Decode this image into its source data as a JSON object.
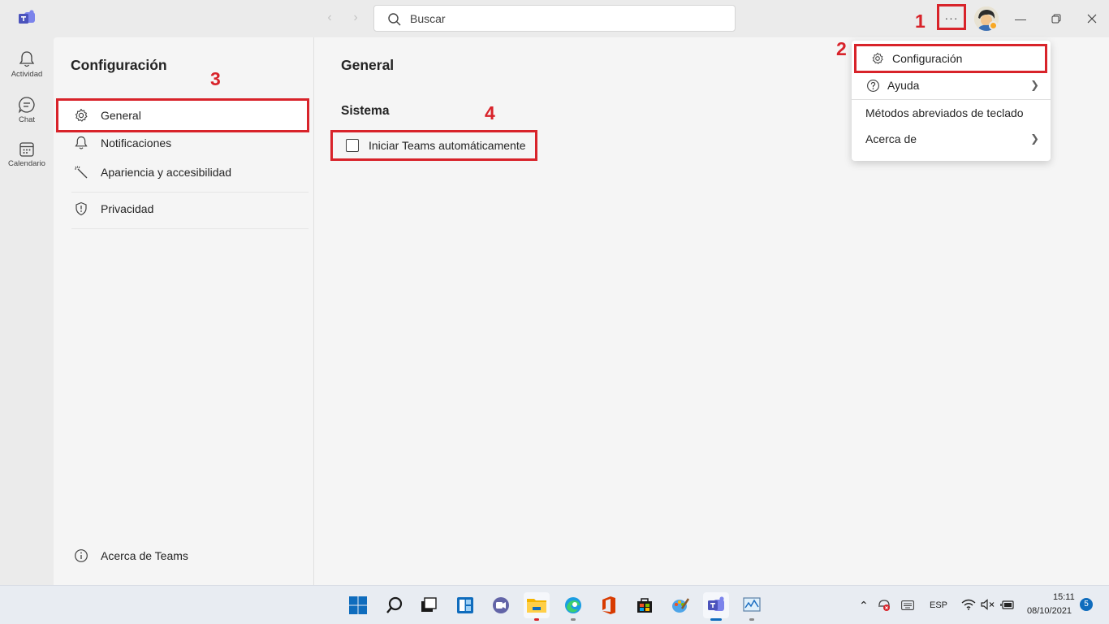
{
  "titlebar": {
    "search_placeholder": "Buscar",
    "more_label": "···"
  },
  "appbar": {
    "items": [
      {
        "label": "Actividad",
        "icon": "bell-icon"
      },
      {
        "label": "Chat",
        "icon": "chat-icon"
      },
      {
        "label": "Calendario",
        "icon": "calendar-icon"
      }
    ]
  },
  "settings_nav": {
    "title": "Configuración",
    "items": [
      {
        "label": "General",
        "icon": "gear-icon",
        "selected": true
      },
      {
        "label": "Notificaciones",
        "icon": "bell-icon"
      },
      {
        "label": "Apariencia y accesibilidad",
        "icon": "wand-icon"
      },
      {
        "label": "Privacidad",
        "icon": "shield-icon"
      }
    ],
    "footer_label": "Acerca de Teams"
  },
  "main": {
    "title": "General",
    "section_title": "Sistema",
    "checkbox_label": "Iniciar Teams automáticamente",
    "checkbox_checked": false
  },
  "menu": {
    "items": [
      {
        "label": "Configuración",
        "icon": "gear-icon"
      },
      {
        "label": "Ayuda",
        "icon": "help-icon",
        "has_submenu": true
      },
      {
        "label": "Métodos abreviados de teclado"
      },
      {
        "label": "Acerca de",
        "has_submenu": true
      }
    ]
  },
  "callouts": [
    "1",
    "2",
    "3",
    "4"
  ],
  "taskbar": {
    "language": "ESP",
    "time": "15:11",
    "date": "08/10/2021",
    "notification_count": "5"
  },
  "colors": {
    "accent_red": "#d8232a",
    "teams_purple": "#5b5fc7",
    "windows_blue": "#0f6cbd"
  }
}
